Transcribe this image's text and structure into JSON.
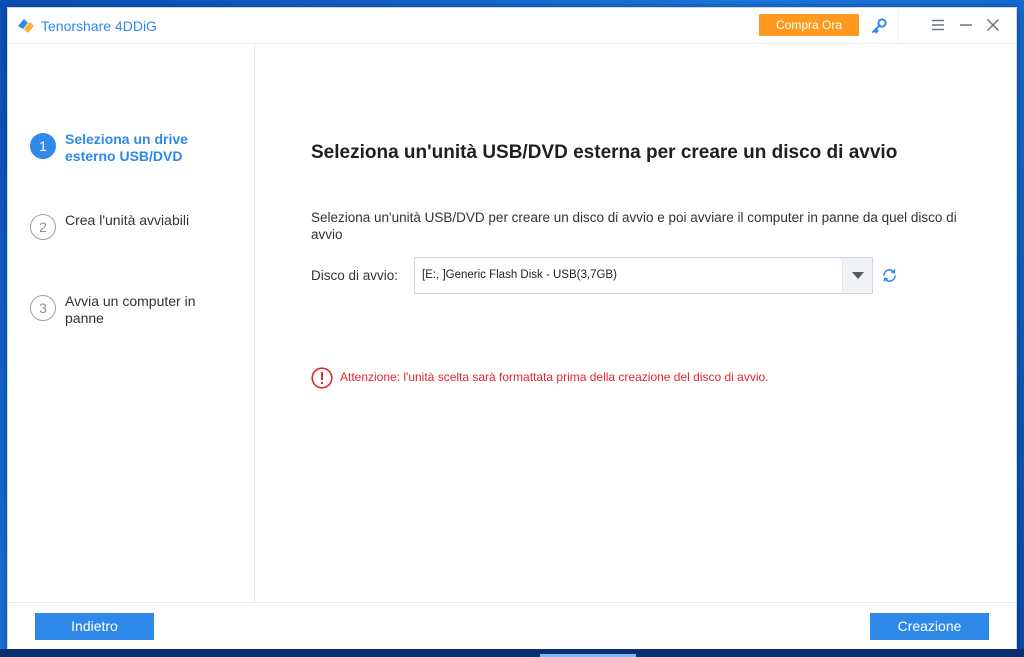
{
  "app": {
    "title": "Tenorshare 4DDiG",
    "buy_label": "Compra Ora",
    "icons": [
      "logo-icon",
      "key-icon",
      "menu-icon",
      "minimize-icon",
      "close-icon"
    ],
    "accent_color": "#2f89e8",
    "buy_color": "#ff9a1f"
  },
  "steps": [
    {
      "number": "1",
      "label": "Seleziona un drive esterno USB/DVD",
      "active": true
    },
    {
      "number": "2",
      "label": "Crea l'unità avviabili",
      "active": false
    },
    {
      "number": "3",
      "label": "Avvia un computer in panne",
      "active": false
    }
  ],
  "main": {
    "heading": "Seleziona un'unità USB/DVD esterna per creare un disco di avvio",
    "description": "Seleziona un'unità USB/DVD per creare un disco di avvio e poi avviare il computer in panne da quel disco di avvio",
    "field_label": "Disco di avvio:",
    "selected_drive": "[E:, ]Generic Flash Disk - USB(3,7GB)",
    "warning": "Attenzione: l'unità scelta sarà formattata prima della creazione del disco di avvio.",
    "warning_color": "#e6262c"
  },
  "footer": {
    "back_label": "Indietro",
    "create_label": "Creazione"
  }
}
